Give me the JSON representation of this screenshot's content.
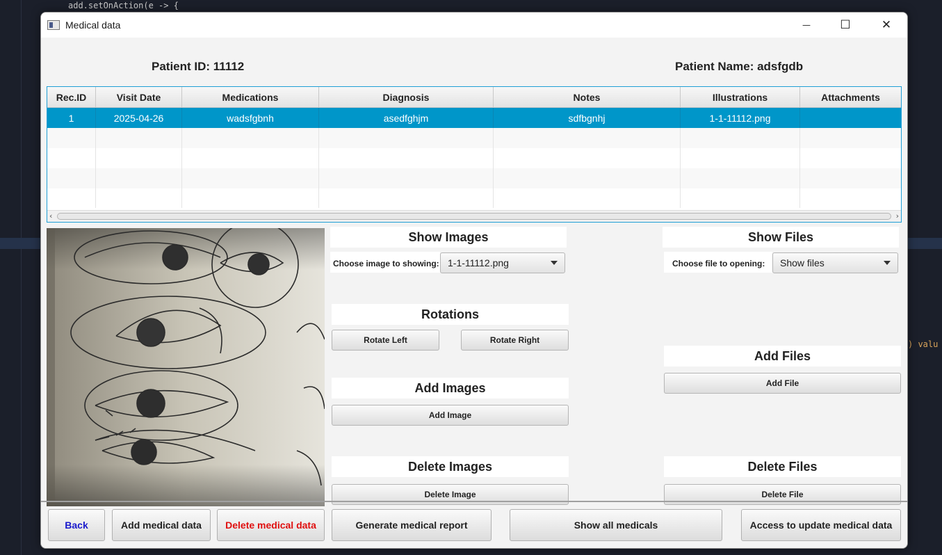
{
  "background_ide": {
    "top_code": "add.setOnAction(e -> {",
    "right_code": ") valu"
  },
  "window": {
    "title": "Medical data",
    "controls": {
      "minimize": "—",
      "maximize": "☐",
      "close": "✕"
    }
  },
  "patient": {
    "id_label": "Patient ID:  11112",
    "name_label": "Patient Name:  adsfgdb"
  },
  "table": {
    "columns": [
      "Rec.ID",
      "Visit Date",
      "Medications",
      "Diagnosis",
      "Notes",
      "Illustrations",
      "Attachments"
    ],
    "rows": [
      [
        "1",
        "2025-04-26",
        "wadsfgbnh",
        "asedfghjm",
        "sdfbgnhj",
        "1-1-11112.png",
        ""
      ]
    ],
    "selected_row": 0
  },
  "images": {
    "show_header": "Show Images",
    "choose_label": "Choose image to showing:",
    "selected_image": "1-1-11112.png",
    "rotations_header": "Rotations",
    "rotate_left": "Rotate Left",
    "rotate_right": "Rotate Right",
    "add_header": "Add Images",
    "add_button": "Add Image",
    "delete_header": "Delete Images",
    "delete_button": "Delete Image"
  },
  "files": {
    "show_header": "Show Files",
    "choose_label": "Choose file to opening:",
    "selected_file": "Show files",
    "add_header": "Add Files",
    "add_button": "Add File",
    "delete_header": "Delete Files",
    "delete_button": "Delete File"
  },
  "bottom": {
    "back": "Back",
    "add_medical": "Add medical data",
    "delete_medical": "Delete medical data",
    "generate_report": "Generate medical report",
    "show_all": "Show all medicals",
    "access_update": "Access to update medical data"
  },
  "colors": {
    "selection": "#0096c9",
    "back_text": "#1a1acc",
    "delete_text": "#e01010",
    "table_border": "#1e9fd6"
  }
}
